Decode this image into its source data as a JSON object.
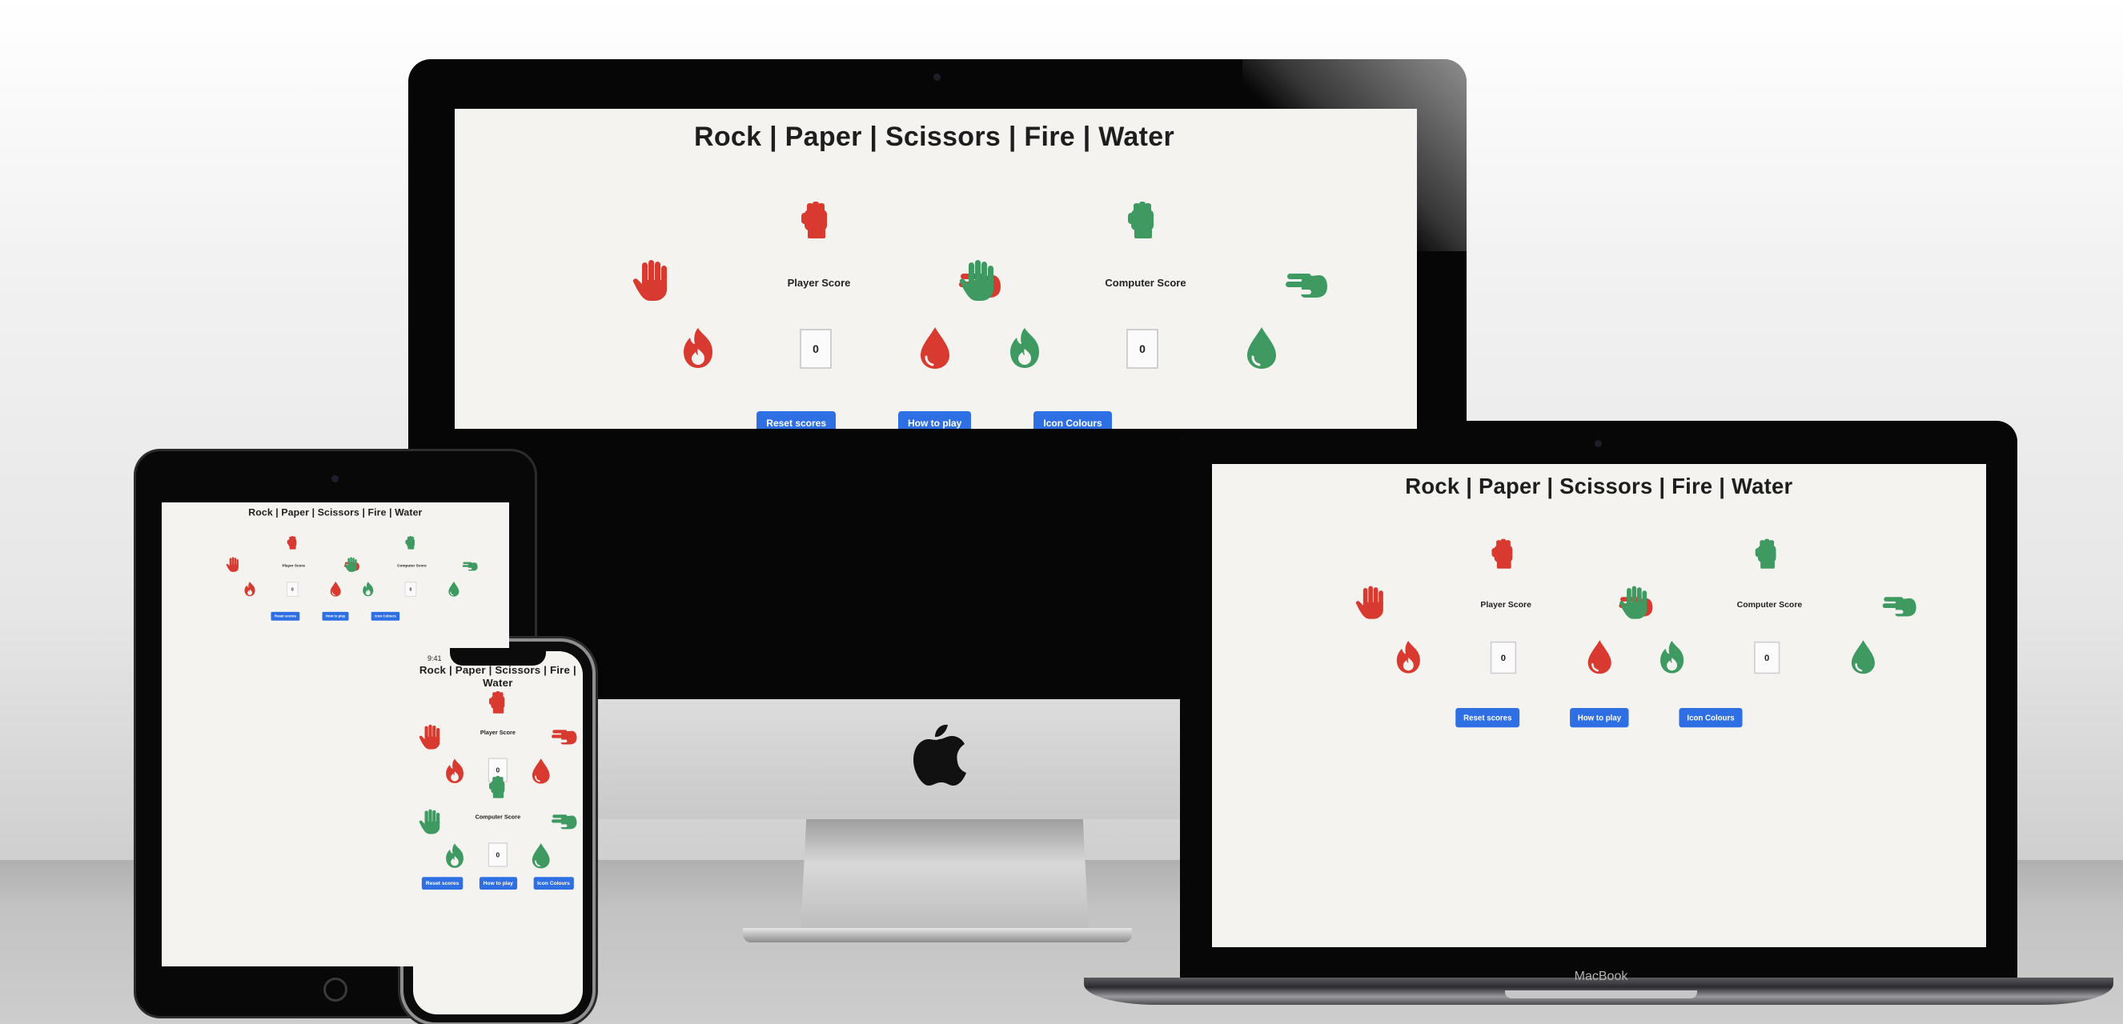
{
  "game": {
    "title": "Rock | Paper | Scissors | Fire | Water",
    "player": {
      "score_label": "Player Score",
      "score": "0",
      "color": "#d93a2f"
    },
    "computer": {
      "score_label": "Computer Score",
      "score": "0",
      "color": "#3f9a62"
    },
    "buttons": {
      "reset": "Reset scores",
      "how_to_play": "How to play",
      "icon_colours": "Icon Colours"
    },
    "icons": [
      "rock-icon",
      "paper-icon",
      "scissors-icon",
      "fire-icon",
      "water-icon"
    ],
    "button_color": "#2f6fe4"
  },
  "devices": {
    "macbook_label": "MacBook",
    "phone_time": "9:41"
  }
}
